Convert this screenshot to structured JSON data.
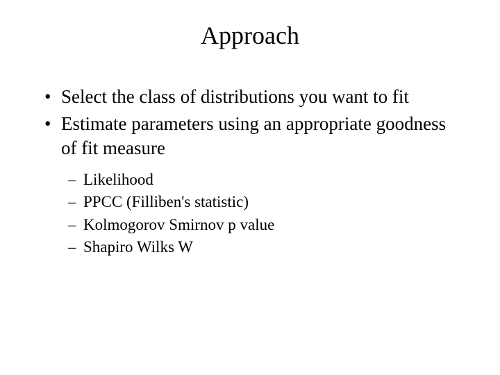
{
  "title": "Approach",
  "bullets": [
    "Select the class of distributions you want to fit",
    "Estimate parameters using an appropriate goodness of fit measure"
  ],
  "subitems": [
    "Likelihood",
    "PPCC (Filliben's statistic)",
    "Kolmogorov Smirnov p value",
    "Shapiro Wilks W"
  ]
}
